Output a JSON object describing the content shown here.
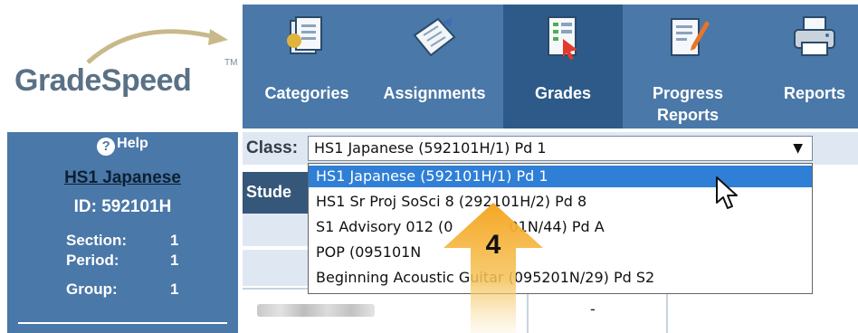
{
  "logo": {
    "text": "GradeSpeed",
    "tm": "TM"
  },
  "nav": {
    "items": [
      {
        "label": "Categories",
        "icon": "categories-icon",
        "active": false
      },
      {
        "label": "Assignments",
        "icon": "assignments-icon",
        "active": false
      },
      {
        "label": "Grades",
        "icon": "grades-icon",
        "active": true
      },
      {
        "label": "Progress Reports",
        "icon": "progress-reports-icon",
        "active": false
      },
      {
        "label": "Reports",
        "icon": "printer-icon",
        "active": false
      }
    ]
  },
  "sidebar": {
    "help": "Help",
    "course": "HS1 Japanese",
    "id_label": "ID:",
    "id_value": "592101H",
    "section_label": "Section:",
    "section_value": "1",
    "period_label": "Period:",
    "period_value": "1",
    "group_label": "Group:",
    "group_value": "1"
  },
  "classbar": {
    "label": "Class:",
    "selected": "HS1 Japanese (592101H/1) Pd 1"
  },
  "dropdown": {
    "options": [
      "HS1 Japanese (592101H/1) Pd 1",
      "HS1 Sr Proj SoSci 8 (292101H/2) Pd 8",
      "S1 Advisory 012 (0",
      "POP (095101N",
      "Beginning Acoustic Guitar (095201N/29) Pd S2"
    ],
    "options_tail": [
      "",
      "",
      "01N/44) Pd A",
      "",
      ""
    ]
  },
  "grid": {
    "student_header": "Stude",
    "cell_value": "-"
  },
  "callout": {
    "number": "4",
    "color": "#f5a623"
  },
  "colors": {
    "nav_bg": "#4a78a8",
    "nav_active": "#2d5a88",
    "selected": "#2f7fd6"
  }
}
